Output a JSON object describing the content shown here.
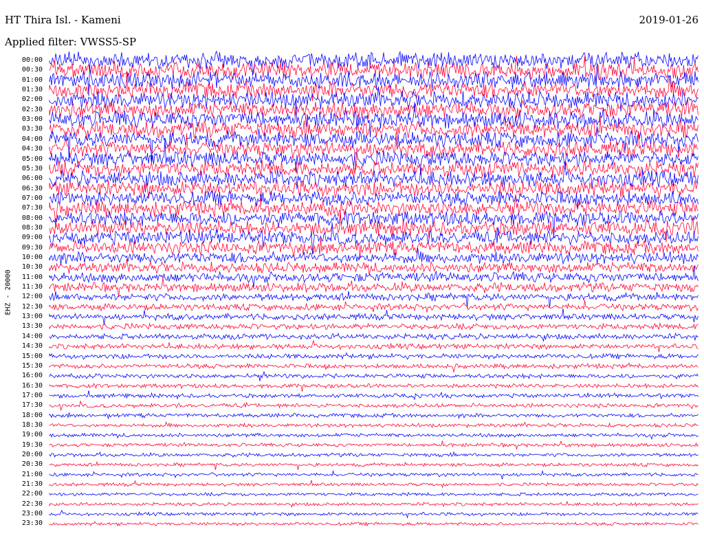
{
  "header": {
    "station": "HT Thira Isl. - Kameni",
    "date": "2019-01-26",
    "filter": "Applied filter: VWSS5-SP"
  },
  "chart_data": {
    "type": "line",
    "title": "HT Thira Isl. - Kameni",
    "ylabel": "EHZ - 20000",
    "rows": [
      "00:00",
      "00:30",
      "01:00",
      "01:30",
      "02:00",
      "02:30",
      "03:00",
      "03:30",
      "04:00",
      "04:30",
      "05:00",
      "05:30",
      "06:00",
      "06:30",
      "07:00",
      "07:30",
      "08:00",
      "08:30",
      "09:00",
      "09:30",
      "10:00",
      "10:30",
      "11:00",
      "11:30",
      "12:00",
      "12:30",
      "13:00",
      "13:30",
      "14:00",
      "14:30",
      "15:00",
      "15:30",
      "16:00",
      "16:30",
      "17:00",
      "17:30",
      "18:00",
      "18:30",
      "19:00",
      "19:30",
      "20:00",
      "20:30",
      "21:00",
      "21:30",
      "22:00",
      "22:30",
      "23:00",
      "23:30"
    ],
    "trace_colors": [
      "#0000ff",
      "#ff0033"
    ],
    "amplitude_level": [
      1.0,
      1.0,
      1.0,
      1.0,
      1.0,
      1.0,
      1.0,
      1.0,
      0.95,
      0.95,
      0.95,
      0.95,
      0.95,
      0.95,
      0.9,
      0.9,
      0.9,
      0.9,
      0.85,
      0.8,
      0.7,
      0.65,
      0.6,
      0.55,
      0.45,
      0.4,
      0.38,
      0.36,
      0.34,
      0.32,
      0.3,
      0.28,
      0.27,
      0.26,
      0.25,
      0.25,
      0.24,
      0.23,
      0.23,
      0.22,
      0.22,
      0.21,
      0.21,
      0.2,
      0.2,
      0.2,
      0.2,
      0.2
    ],
    "grid": false
  }
}
